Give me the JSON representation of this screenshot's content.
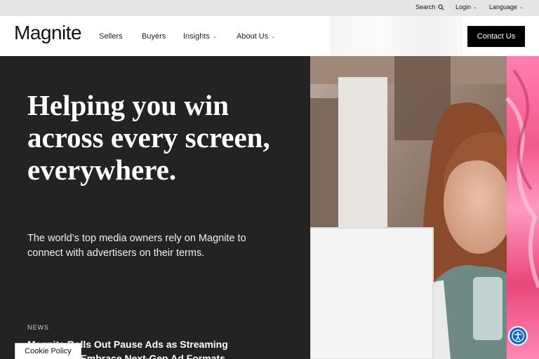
{
  "utility": {
    "search": "Search",
    "login": "Login",
    "language": "Language"
  },
  "nav": {
    "logo": "Magnite",
    "items": [
      {
        "label": "Sellers"
      },
      {
        "label": "Buyers"
      },
      {
        "label": "Insights"
      },
      {
        "label": "About Us"
      }
    ],
    "contact": "Contact Us"
  },
  "hero": {
    "title": "Helping you win across every screen, everywhere.",
    "subtitle": "The world’s top media owners rely on Magnite to connect with advertisers on their terms.",
    "news_label": "NEWS",
    "news_headline": "Magnite Rolls Out Pause Ads as Streaming Publishers Embrace Next-Gen Ad Formats"
  },
  "cookie": "Cookie Policy",
  "colors": {
    "hero_bg": "#232323",
    "contact_bg": "#000000",
    "accessibility": "#1565c0",
    "accent_stripe": "#ff6fa8"
  },
  "icons": {
    "search": "search-icon",
    "caret": "chevron-down-icon",
    "accessibility": "accessibility-icon"
  }
}
